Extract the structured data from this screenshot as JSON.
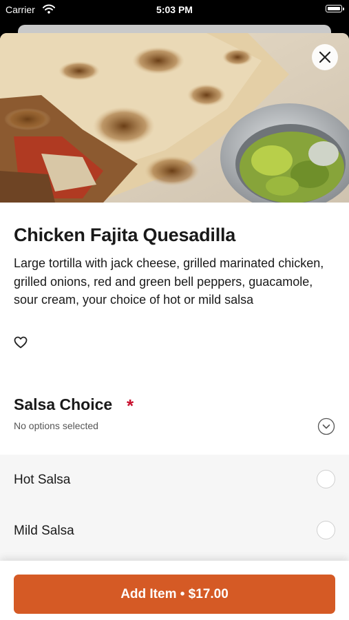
{
  "status_bar": {
    "carrier": "Carrier",
    "time": "5:03 PM"
  },
  "item": {
    "title": "Chicken Fajita Quesadilla",
    "description": "Large tortilla with jack cheese, grilled marinated chicken, grilled onions, red and green bell peppers, guacamole, sour cream, your choice of hot or mild salsa"
  },
  "icons": {
    "close": "close-icon",
    "favorite": "heart-outline-icon",
    "collapse": "chevron-down-circle-icon",
    "wifi": "wifi-icon",
    "battery": "battery-icon"
  },
  "modifier_group": {
    "title": "Salsa Choice",
    "required_mark": "*",
    "subtitle": "No options selected",
    "options": [
      {
        "label": "Hot Salsa",
        "selected": false
      },
      {
        "label": "Mild Salsa",
        "selected": false
      }
    ]
  },
  "footer": {
    "add_button_label": "Add Item • $17.00"
  },
  "colors": {
    "accent": "#d55a25",
    "required": "#c8102e",
    "text": "#191919",
    "options_background": "#f6f6f6"
  }
}
